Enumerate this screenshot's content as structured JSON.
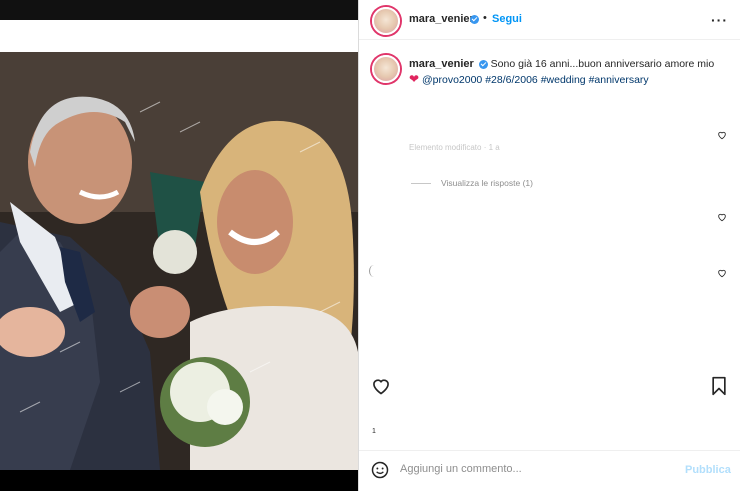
{
  "post": {
    "username": "mara_venier",
    "follow_label": "Segui",
    "more_icon": "more-options-icon",
    "caption": {
      "username": "mara_venier",
      "text": "Sono già 16 anni...buon anniversario amore mio",
      "mention": "@provo2000",
      "date_tag": "#28/6/2006",
      "hashtag_1": "#wedding",
      "hashtag_2": "#anniversary",
      "edited_note": "Elemento modificato · 1 a"
    },
    "replies_label": "Visualizza le risposte (1)",
    "likes_count": "1"
  },
  "comment_bar": {
    "placeholder": "Aggiungi un commento...",
    "publish_label": "Pubblica"
  },
  "colors": {
    "accent": "#0095f6",
    "verified": "#3897f0",
    "heart": "#e0245e"
  }
}
